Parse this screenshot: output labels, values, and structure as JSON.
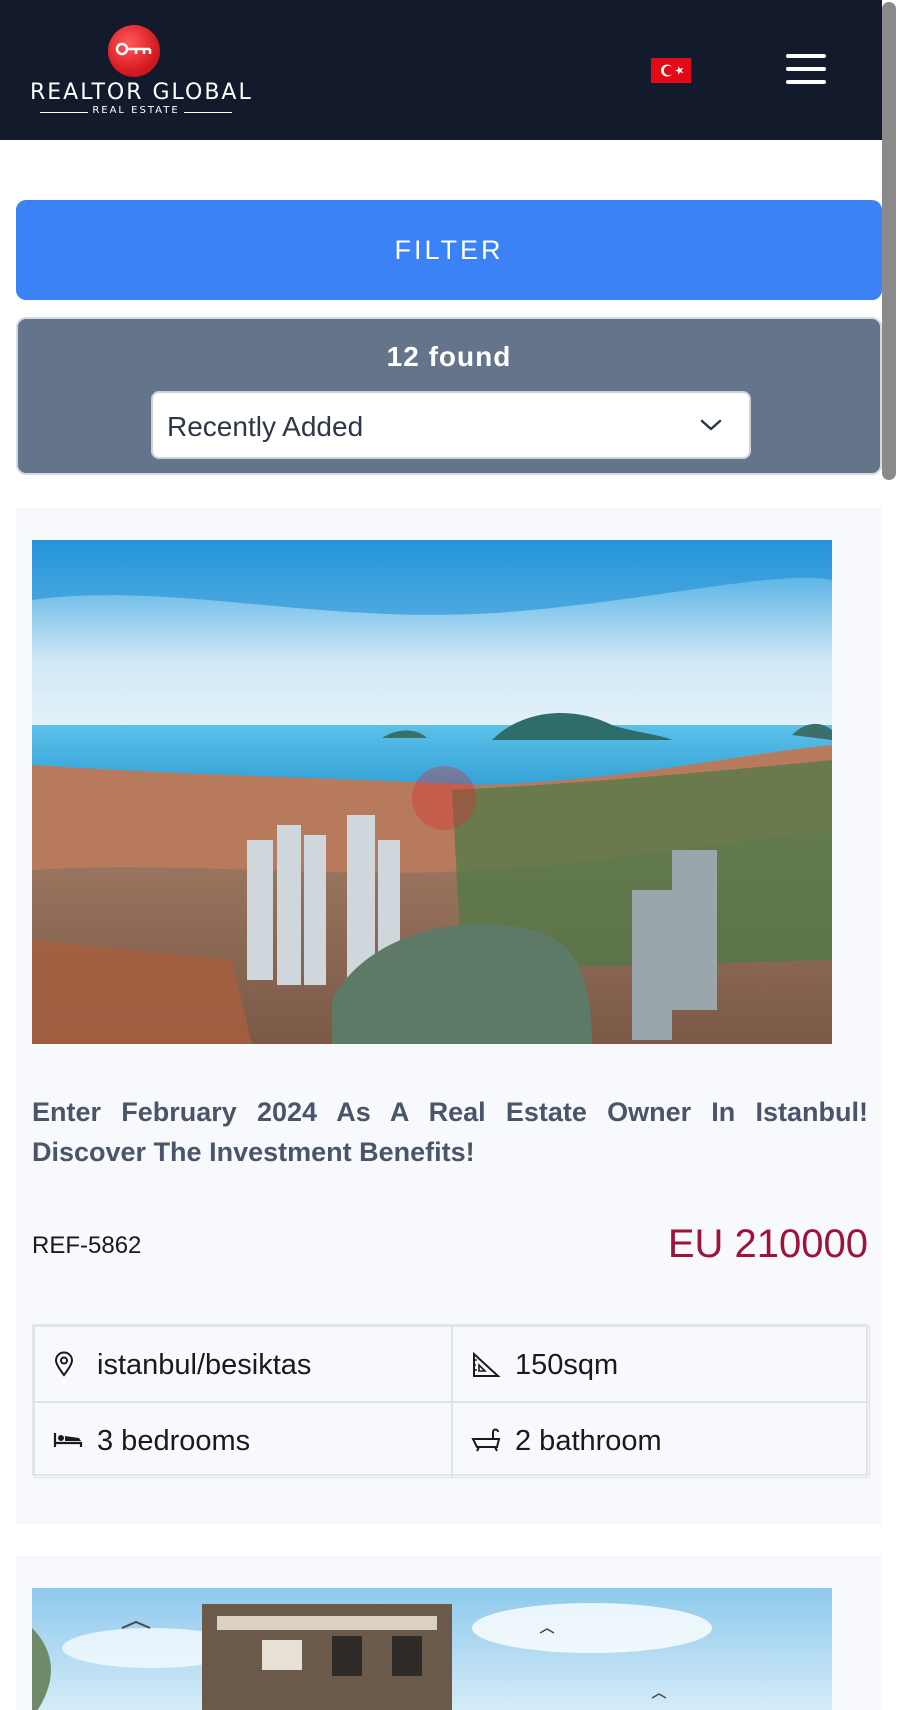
{
  "header": {
    "brand_title": "REALTOR GLOBAL",
    "brand_subtitle": "REAL ESTATE",
    "language_flag": "turkey-flag",
    "menu_icon": "hamburger-icon"
  },
  "filter": {
    "button_label": "FILTER",
    "results_count": "12 found",
    "sort_selected": "Recently Added"
  },
  "listings": [
    {
      "title": "Enter February 2024 As A Real Estate Owner In Istanbul! Discover The Investment Benefits!",
      "ref": "REF-5862",
      "price": "EU 210000",
      "location": "istanbul/besiktas",
      "area": "150sqm",
      "bedrooms": "3 bedrooms",
      "bathrooms": "2 bathroom"
    }
  ],
  "colors": {
    "header_bg": "#121a2c",
    "filter_button": "#3b82f6",
    "results_panel": "#64748b",
    "price": "#a0123a",
    "title": "#4a5568"
  }
}
